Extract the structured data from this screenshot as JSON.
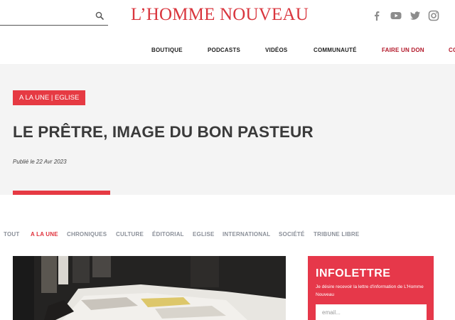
{
  "header": {
    "logo": "L’HOMME NOUVEAU",
    "search": {
      "value": "",
      "placeholder": ""
    },
    "social": [
      "facebook-icon",
      "youtube-icon",
      "twitter-icon",
      "instagram-icon"
    ]
  },
  "nav": [
    {
      "label": "BOUTIQUE"
    },
    {
      "label": "PODCASTS"
    },
    {
      "label": "VIDÉOS"
    },
    {
      "label": "COMMUNAUTÉ"
    },
    {
      "label": "FAIRE UN DON"
    },
    {
      "label": "CO"
    }
  ],
  "colors": {
    "brand_red": "#e63a43",
    "logo_red": "#d9363e",
    "donate_red": "#b3192a",
    "hero_bg": "#f4f4f4"
  },
  "article": {
    "category_badge": "A LA UNE | EGLISE",
    "title": "LE PRÊTRE, IMAGE DU BON PASTEUR",
    "published": "Publié le 22 Avr 2023"
  },
  "category_tabs": [
    {
      "label": "TOUT"
    },
    {
      "label": "A LA UNE",
      "active": true
    },
    {
      "label": "CHRONIQUES"
    },
    {
      "label": "CULTURE"
    },
    {
      "label": "ÉDITORIAL"
    },
    {
      "label": "EGLISE"
    },
    {
      "label": "INTERNATIONAL"
    },
    {
      "label": "SOCIÉTÉ"
    },
    {
      "label": "TRIBUNE LIBRE"
    }
  ],
  "newsletter": {
    "title": "INFOLETTRE",
    "description": "Je désire recevoir la lettre d'information de L'Homme Nouveau",
    "email_placeholder": "email..."
  }
}
